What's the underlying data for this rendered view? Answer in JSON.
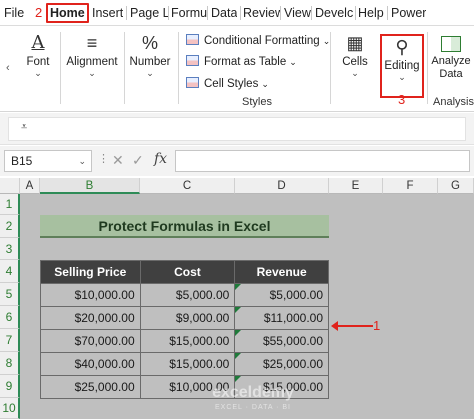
{
  "tabs": [
    {
      "label": "File"
    },
    {
      "label": "Home"
    },
    {
      "label": "Insert"
    },
    {
      "label": "Page L"
    },
    {
      "label": "Formu"
    },
    {
      "label": "Data"
    },
    {
      "label": "Review"
    },
    {
      "label": "View"
    },
    {
      "label": "Develc"
    },
    {
      "label": "Help"
    },
    {
      "label": "Power"
    }
  ],
  "annotations": {
    "step1": "1",
    "step2": "2",
    "step3": "3"
  },
  "ribbon": {
    "font_label": "Font",
    "alignment_label": "Alignment",
    "number_label": "Number",
    "percent_glyph": "%",
    "conditional_formatting": "Conditional Formatting",
    "format_as_table": "Format as Table",
    "cell_styles": "Cell Styles",
    "styles_group": "Styles",
    "cells_label": "Cells",
    "editing_label": "Editing",
    "analyze_data_line1": "Analyze",
    "analyze_data_line2": "Data",
    "analysis_group": "Analysis"
  },
  "formula_bar": {
    "name_box": "B15",
    "fx": "fx",
    "value": ""
  },
  "columns": [
    "A",
    "B",
    "C",
    "D",
    "E",
    "F",
    "G"
  ],
  "rows": [
    "1",
    "2",
    "3",
    "4",
    "5",
    "6",
    "7",
    "8",
    "9",
    "10"
  ],
  "sheet": {
    "title": "Protect Formulas in Excel",
    "headers": [
      "Selling Price",
      "Cost",
      "Revenue"
    ],
    "data": [
      [
        "$10,000.00",
        "$5,000.00",
        "$5,000.00"
      ],
      [
        "$20,000.00",
        "$9,000.00",
        "$11,000.00"
      ],
      [
        "$70,000.00",
        "$15,000.00",
        "$55,000.00"
      ],
      [
        "$40,000.00",
        "$15,000.00",
        "$25,000.00"
      ],
      [
        "$25,000.00",
        "$10,000.00",
        "$15,000.00"
      ]
    ]
  },
  "watermark": {
    "name": "exceldemy",
    "tagline": "EXCEL · DATA · BI"
  },
  "colors": {
    "annotation_red": "#e0231c",
    "header_dark": "#404040",
    "title_green": "#a7c0a0",
    "grid_gray": "#bfbfbf"
  }
}
